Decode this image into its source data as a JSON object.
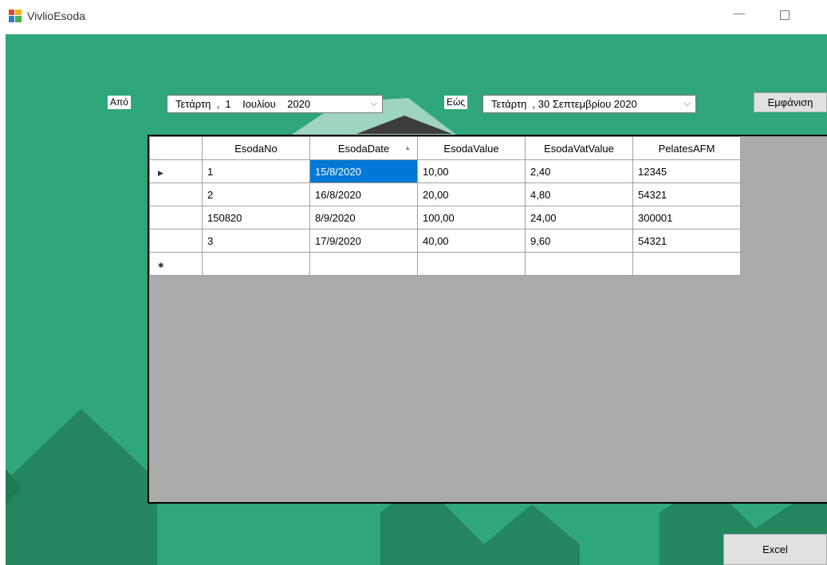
{
  "window": {
    "title": "VivlioEsoda",
    "min_glyph": "—"
  },
  "filters": {
    "from_label": "Από",
    "from_date": "Τετάρτη  ,  1    Ιουλίου    2020",
    "to_label": "Εώς",
    "to_date": "Τετάρτη  , 30 Σεπτεμβρίου 2020",
    "show_button": "Εμφάνιση",
    "chevron": "⌵"
  },
  "grid": {
    "columns": [
      "EsodaNo",
      "EsodaDate",
      "EsodaValue",
      "EsodaVatValue",
      "PelatesAFM"
    ],
    "sort_indicator": "▲",
    "current_row_marker": "▶",
    "new_row_marker": "✱",
    "rows": [
      [
        "1",
        "15/8/2020",
        "10,00",
        "2,40",
        "12345"
      ],
      [
        "2",
        "16/8/2020",
        "20,00",
        "4,80",
        "54321"
      ],
      [
        "150820",
        "8/9/2020",
        "100,00",
        "24,00",
        "300001"
      ],
      [
        "3",
        "17/9/2020",
        "40,00",
        "9,60",
        "54321"
      ]
    ]
  },
  "footer": {
    "excel_button": "Excel"
  },
  "colors": {
    "background": "#2fa77a",
    "mountain_dark": "#23865f",
    "grid_empty": "#ababab",
    "selection": "#0078d7"
  }
}
